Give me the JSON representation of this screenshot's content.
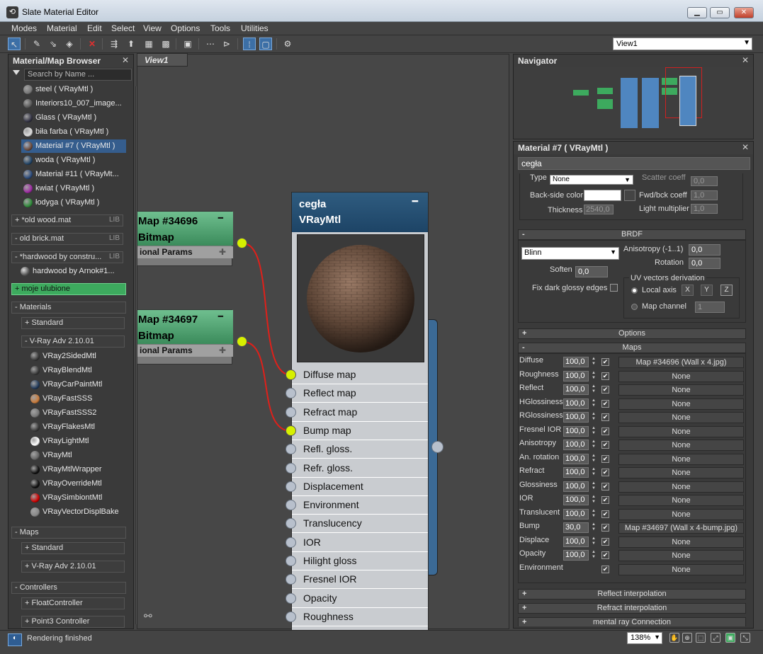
{
  "window": {
    "title": "Slate Material Editor",
    "app_icon": "3ds-max-icon",
    "buttons": [
      "minimize",
      "maximize",
      "close"
    ]
  },
  "menu": [
    "Modes",
    "Material",
    "Edit",
    "Select",
    "View",
    "Options",
    "Tools",
    "Utilities"
  ],
  "toolbar": {
    "icons": [
      "select-tool-icon",
      "pick-material-icon",
      "put-material-icon",
      "assign-material-icon",
      "delete-icon",
      "move-children-icon",
      "layout-icon",
      "background-icon",
      "preview-icon",
      "show-map-icon",
      "lay-out-all-icon",
      "children-icon",
      "selected-icon",
      "navigator-icon"
    ],
    "view_select": "View1"
  },
  "browser": {
    "title": "Material/Map Browser",
    "search_placeholder": "Search by Name ...",
    "scene_items": [
      {
        "name": "steel  ( VRayMtl )",
        "color": "#777"
      },
      {
        "name": "Interiors10_007_image...",
        "color": "#555"
      },
      {
        "name": "Glass  ( VRayMtl )",
        "color": "#334"
      },
      {
        "name": "biła farba  ( VRayMtl )",
        "color": "#ddd"
      },
      {
        "name": "Material #7  ( VRayMtl )",
        "color": "#6b4a3a",
        "selected": true
      },
      {
        "name": "woda  ( VRayMtl )",
        "color": "#246"
      },
      {
        "name": "Material #11  ( VRayMt...",
        "color": "#2b4a7a"
      },
      {
        "name": "kwiat  ( VRayMtl )",
        "color": "#9b2aa0"
      },
      {
        "name": "łodyga  ( VRayMtl )",
        "color": "#2f8a3a"
      }
    ],
    "libs": [
      {
        "label": "+ *old wood.mat",
        "tag": "LIB"
      },
      {
        "label": "- old brick.mat",
        "tag": "LIB"
      },
      {
        "label": "- *hardwood by constru...",
        "tag": "LIB"
      }
    ],
    "hardwood_item": "hardwood by Arnok#1...",
    "favorites": "+ moje ulubione",
    "materials_header": "- Materials",
    "standard": "+ Standard",
    "vray": "- V-Ray Adv 2.10.01",
    "vray_items": [
      {
        "name": "VRay2SidedMtl",
        "color": "#3a3a3a"
      },
      {
        "name": "VRayBlendMtl",
        "color": "#3a3a3a"
      },
      {
        "name": "VRayCarPaintMtl",
        "color": "#223a5a"
      },
      {
        "name": "VRayFastSSS",
        "color": "#c87a3a"
      },
      {
        "name": "VRayFastSSS2",
        "color": "#777"
      },
      {
        "name": "VRayFlakesMtl",
        "color": "#3a3a3a"
      },
      {
        "name": "VRayLightMtl",
        "color": "#fff"
      },
      {
        "name": "VRayMtl",
        "color": "#666"
      },
      {
        "name": "VRayMtlWrapper",
        "color": "#111"
      },
      {
        "name": "VRayOverrideMtl",
        "color": "#111"
      },
      {
        "name": "VRaySimbiontMtl",
        "color": "#c00"
      },
      {
        "name": "VRayVectorDisplBake",
        "color": "#888"
      }
    ],
    "maps_header": "- Maps",
    "maps_standard": "+ Standard",
    "maps_vray": "+ V-Ray Adv 2.10.01",
    "controllers_header": "- Controllers",
    "float_ctrl": "+ FloatController",
    "point3_ctrl": "+ Point3 Controller"
  },
  "view": {
    "tab": "View1",
    "map1": {
      "title_a": "Map #34696",
      "title_b": "Bitmap",
      "params": "ional Params"
    },
    "map2": {
      "title_a": "Map #34697",
      "title_b": "Bitmap",
      "params": "ional Params"
    },
    "node": {
      "name": "cegła",
      "type": "VRayMtl",
      "slots": [
        {
          "label": "Diffuse map",
          "connected": true
        },
        {
          "label": "Reflect map"
        },
        {
          "label": "Refract map"
        },
        {
          "label": "Bump map",
          "connected": true
        },
        {
          "label": "Refl. gloss."
        },
        {
          "label": "Refr. gloss."
        },
        {
          "label": "Displacement"
        },
        {
          "label": "Environment"
        },
        {
          "label": "Translucency"
        },
        {
          "label": "IOR"
        },
        {
          "label": "Hilight gloss"
        },
        {
          "label": "Fresnel IOR"
        },
        {
          "label": "Opacity"
        },
        {
          "label": "Roughness"
        }
      ]
    }
  },
  "navigator": {
    "title": "Navigator"
  },
  "props": {
    "title": "Material #7  ( VRayMtl )",
    "name_value": "cegła",
    "type_label": "Type",
    "type_value": "None",
    "scatter_label": "Scatter coeff",
    "scatter_value": "0,0",
    "backside_label": "Back-side color",
    "fwdbck_label": "Fwd/bck coeff",
    "fwdbck_value": "1,0",
    "thickness_label": "Thickness",
    "thickness_value": "2540,0",
    "lightmult_label": "Light multiplier",
    "lightmult_value": "1,0",
    "brdf": "BRDF",
    "brdf_type": "Blinn",
    "aniso_label": "Anisotropy (-1..1)",
    "aniso_value": "0,0",
    "rotation_label": "Rotation",
    "rotation_value": "0,0",
    "soften_label": "Soften",
    "soften_value": "0,0",
    "fixdark_label": "Fix dark glossy edges",
    "uv_label": "UV vectors derivation",
    "local_axis": "Local axis",
    "x": "X",
    "y": "Y",
    "z": "Z",
    "map_channel": "Map channel",
    "map_channel_value": "1",
    "options": "Options",
    "maps": "Maps",
    "maps_rows": [
      {
        "label": "Diffuse",
        "value": "100,0",
        "map": "Map #34696 (Wall x 4.jpg)"
      },
      {
        "label": "Roughness",
        "value": "100,0",
        "map": "None"
      },
      {
        "label": "Reflect",
        "value": "100,0",
        "map": "None"
      },
      {
        "label": "HGlossiness",
        "value": "100,0",
        "map": "None"
      },
      {
        "label": "RGlossiness",
        "value": "100,0",
        "map": "None"
      },
      {
        "label": "Fresnel IOR",
        "value": "100,0",
        "map": "None"
      },
      {
        "label": "Anisotropy",
        "value": "100,0",
        "map": "None"
      },
      {
        "label": "An. rotation",
        "value": "100,0",
        "map": "None"
      },
      {
        "label": "Refract",
        "value": "100,0",
        "map": "None"
      },
      {
        "label": "Glossiness",
        "value": "100,0",
        "map": "None"
      },
      {
        "label": "IOR",
        "value": "100,0",
        "map": "None"
      },
      {
        "label": "Translucent",
        "value": "100,0",
        "map": "None"
      },
      {
        "label": "Bump",
        "value": "30,0",
        "map": "Map #34697 (Wall x 4-bump.jpg)"
      },
      {
        "label": "Displace",
        "value": "100,0",
        "map": "None"
      },
      {
        "label": "Opacity",
        "value": "100,0",
        "map": "None"
      },
      {
        "label": "Environment",
        "value": "",
        "map": "None"
      }
    ],
    "reflect_interp": "Reflect interpolation",
    "refract_interp": "Refract interpolation",
    "mentalray": "mental ray Connection"
  },
  "status": {
    "message": "Rendering finished",
    "zoom": "138%"
  },
  "colors": {
    "accent": "#355d8d",
    "node_header": "#1d4466",
    "map_header": "#3b8b5b",
    "socket_on": "#d7f000",
    "wire": "#e0201a"
  }
}
